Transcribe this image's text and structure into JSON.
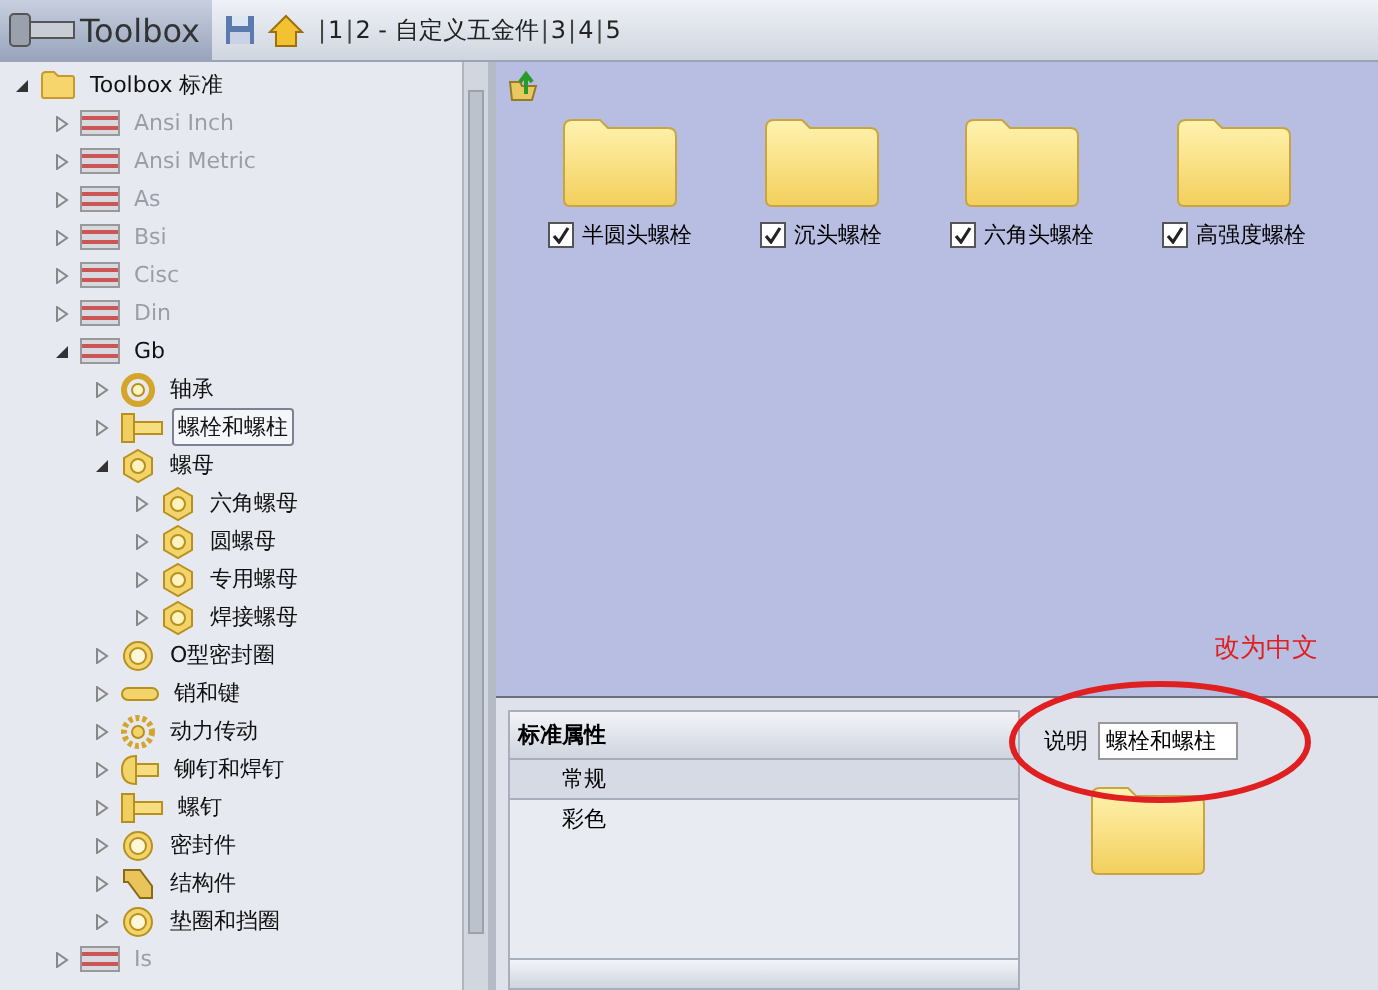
{
  "toolbar": {
    "title": "Toolbox",
    "separator": "|",
    "breadcrumbs": [
      {
        "label": "1"
      },
      {
        "label": "2 - 自定义五金件"
      },
      {
        "label": "3"
      },
      {
        "label": "4"
      },
      {
        "label": "5"
      }
    ]
  },
  "tree": [
    {
      "label": "Toolbox 标准",
      "kind": "folder",
      "expanded": true,
      "selected": false,
      "disabled": false,
      "children": [
        {
          "label": "Ansi Inch",
          "kind": "flag",
          "expanded": false,
          "selected": false,
          "disabled": true
        },
        {
          "label": "Ansi Metric",
          "kind": "flag",
          "expanded": false,
          "selected": false,
          "disabled": true
        },
        {
          "label": "As",
          "kind": "flag",
          "expanded": false,
          "selected": false,
          "disabled": true
        },
        {
          "label": "Bsi",
          "kind": "flag",
          "expanded": false,
          "selected": false,
          "disabled": true
        },
        {
          "label": "Cisc",
          "kind": "flag",
          "expanded": false,
          "selected": false,
          "disabled": true
        },
        {
          "label": "Din",
          "kind": "flag",
          "expanded": false,
          "selected": false,
          "disabled": true
        },
        {
          "label": "Gb",
          "kind": "flag",
          "expanded": true,
          "selected": false,
          "disabled": false,
          "children": [
            {
              "label": "轴承",
              "kind": "bearing",
              "expanded": false,
              "selected": false,
              "disabled": false
            },
            {
              "label": "螺栓和螺柱",
              "kind": "bolt",
              "expanded": false,
              "selected": true,
              "disabled": false
            },
            {
              "label": "螺母",
              "kind": "nut",
              "expanded": true,
              "selected": false,
              "disabled": false,
              "children": [
                {
                  "label": "六角螺母",
                  "kind": "nut",
                  "expanded": false,
                  "selected": false,
                  "disabled": false
                },
                {
                  "label": "圆螺母",
                  "kind": "nut",
                  "expanded": false,
                  "selected": false,
                  "disabled": false
                },
                {
                  "label": "专用螺母",
                  "kind": "nut",
                  "expanded": false,
                  "selected": false,
                  "disabled": false
                },
                {
                  "label": "焊接螺母",
                  "kind": "nut",
                  "expanded": false,
                  "selected": false,
                  "disabled": false
                }
              ]
            },
            {
              "label": "O型密封圈",
              "kind": "ring",
              "expanded": false,
              "selected": false,
              "disabled": false
            },
            {
              "label": "销和键",
              "kind": "pin",
              "expanded": false,
              "selected": false,
              "disabled": false
            },
            {
              "label": "动力传动",
              "kind": "gear",
              "expanded": false,
              "selected": false,
              "disabled": false
            },
            {
              "label": "铆钉和焊钉",
              "kind": "rivet",
              "expanded": false,
              "selected": false,
              "disabled": false
            },
            {
              "label": "螺钉",
              "kind": "bolt",
              "expanded": false,
              "selected": false,
              "disabled": false
            },
            {
              "label": "密封件",
              "kind": "ring",
              "expanded": false,
              "selected": false,
              "disabled": false
            },
            {
              "label": "结构件",
              "kind": "beam",
              "expanded": false,
              "selected": false,
              "disabled": false
            },
            {
              "label": "垫圈和挡圈",
              "kind": "ring",
              "expanded": false,
              "selected": false,
              "disabled": false
            }
          ]
        },
        {
          "label": "Is",
          "kind": "flag",
          "expanded": false,
          "selected": false,
          "disabled": true
        }
      ]
    }
  ],
  "folders": [
    {
      "label": "半圆头螺栓",
      "checked": true
    },
    {
      "label": "沉头螺栓",
      "checked": true
    },
    {
      "label": "六角头螺栓",
      "checked": true
    },
    {
      "label": "高强度螺栓",
      "checked": true
    }
  ],
  "properties": {
    "header": "标准属性",
    "rows": [
      {
        "label": "常规",
        "selected": true
      },
      {
        "label": "彩色",
        "selected": false
      }
    ]
  },
  "description": {
    "label": "说明",
    "value": "螺栓和螺柱"
  },
  "annotation": {
    "text": "改为中文"
  }
}
